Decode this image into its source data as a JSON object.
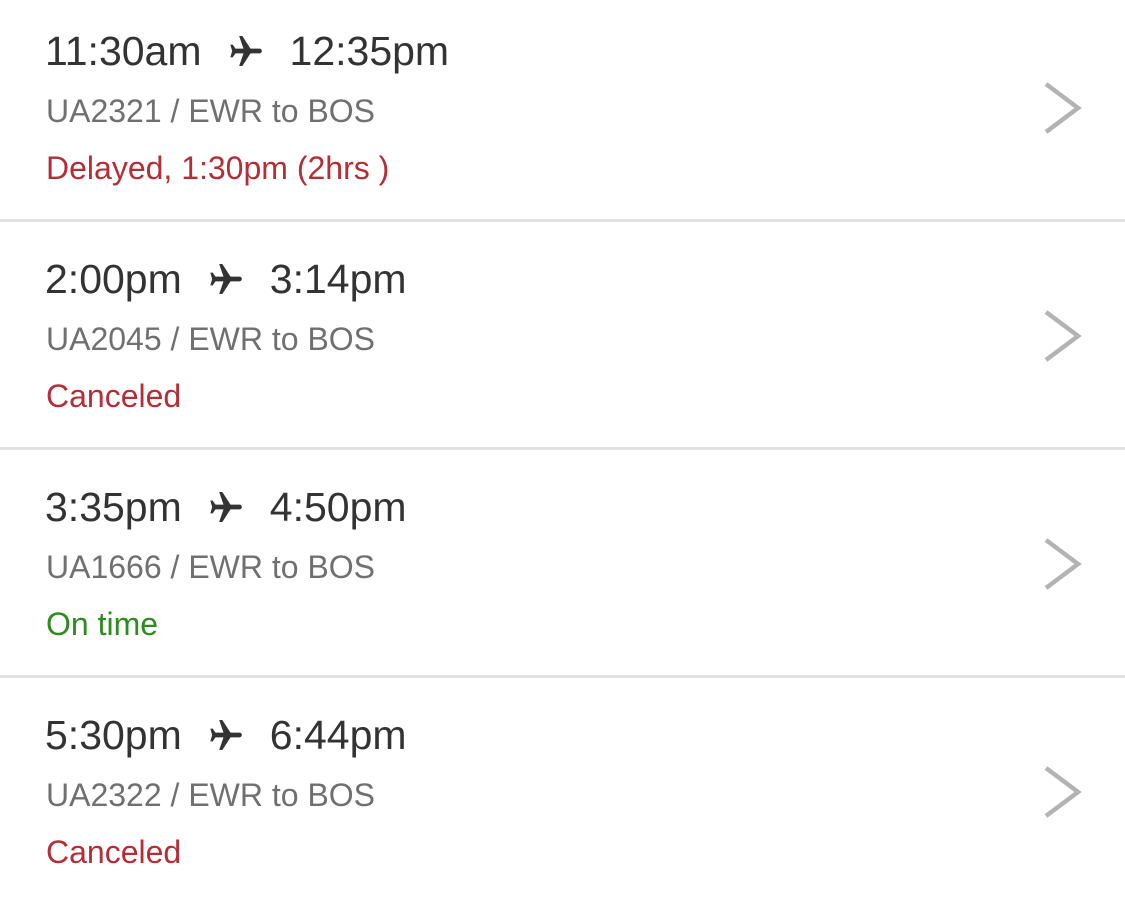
{
  "colors": {
    "status_red": "#b52d35",
    "status_green": "#2e8b1e",
    "time_text": "#333333",
    "info_text": "#707070",
    "chevron": "#b3b3b3",
    "divider": "#e2e2e2"
  },
  "flights": [
    {
      "depart": "11:30am",
      "arrive": "12:35pm",
      "info": "UA2321 / EWR to BOS",
      "status": "Delayed, 1:30pm (2hrs )",
      "status_color": "#b52d35",
      "icon": "airplane-icon",
      "chevron_icon": "chevron-right-icon"
    },
    {
      "depart": "2:00pm",
      "arrive": "3:14pm",
      "info": "UA2045 / EWR to BOS",
      "status": "Canceled",
      "status_color": "#b52d35",
      "icon": "airplane-icon",
      "chevron_icon": "chevron-right-icon"
    },
    {
      "depart": "3:35pm",
      "arrive": "4:50pm",
      "info": "UA1666 / EWR to BOS",
      "status": "On time",
      "status_color": "#2e8b1e",
      "icon": "airplane-icon",
      "chevron_icon": "chevron-right-icon"
    },
    {
      "depart": "5:30pm",
      "arrive": "6:44pm",
      "info": "UA2322 / EWR to BOS",
      "status": "Canceled",
      "status_color": "#b52d35",
      "icon": "airplane-icon",
      "chevron_icon": "chevron-right-icon"
    }
  ]
}
